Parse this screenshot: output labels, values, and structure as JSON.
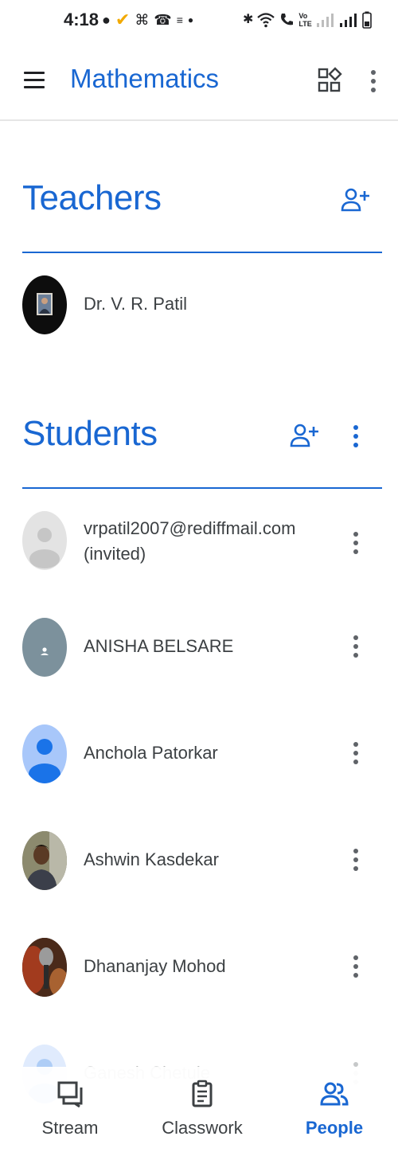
{
  "status_bar": {
    "time": "4:18",
    "left_icons": [
      "messenger-icon",
      "check-icon",
      "app-icon",
      "whatsapp-icon",
      "notification-icon",
      "dot-icon"
    ],
    "right_icons": [
      "bluetooth-icon",
      "wifi-icon",
      "call-icon",
      "volte-icon",
      "signal-icon",
      "signal-icon",
      "battery-icon"
    ],
    "volte_label": "Vo\nLTE"
  },
  "app_bar": {
    "title": "Mathematics",
    "accent_color": "#1967d2"
  },
  "teachers": {
    "title": "Teachers",
    "items": [
      {
        "name": "Dr. V. R. Patil",
        "avatar": "photo"
      }
    ]
  },
  "students": {
    "title": "Students",
    "items": [
      {
        "name": "vrpatil2007@rediffmail.com",
        "status": "(invited)",
        "avatar": "default-gray"
      },
      {
        "name": "ANISHA BELSARE",
        "avatar": "default-slate"
      },
      {
        "name": "Anchola Patorkar",
        "avatar": "default-blue"
      },
      {
        "name": "Ashwin Kasdekar",
        "avatar": "photo"
      },
      {
        "name": "Dhananjay Mohod",
        "avatar": "photo"
      },
      {
        "name": "Ganesh Chetule",
        "avatar": "default-blue"
      }
    ]
  },
  "bottom_nav": {
    "items": [
      {
        "label": "Stream",
        "icon": "stream-icon",
        "active": false
      },
      {
        "label": "Classwork",
        "icon": "classwork-icon",
        "active": false
      },
      {
        "label": "People",
        "icon": "people-icon",
        "active": true
      }
    ]
  }
}
